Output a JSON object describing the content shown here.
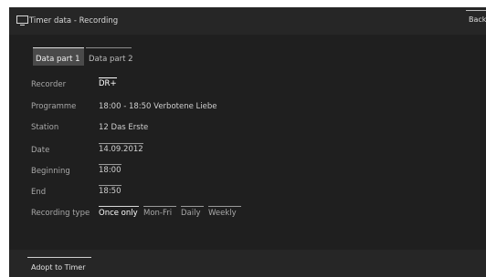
{
  "window": {
    "title": "Timer data - Recording",
    "icon": "tv-icon"
  },
  "header": {
    "back_label": "Back"
  },
  "tabs": [
    {
      "label": "Data part 1",
      "active": true
    },
    {
      "label": "Data part 2",
      "active": false
    }
  ],
  "fields": {
    "recorder": {
      "label": "Recorder",
      "value": "DR+"
    },
    "programme": {
      "label": "Programme",
      "value": "18:00 - 18:50 Verbotene Liebe"
    },
    "station": {
      "label": "Station",
      "value": "12 Das Erste"
    },
    "date": {
      "label": "Date",
      "value": "14.09.2012"
    },
    "beginning": {
      "label": "Beginning",
      "value": "18:00"
    },
    "end": {
      "label": "End",
      "value": "18:50"
    },
    "recording_type": {
      "label": "Recording type",
      "options": [
        "Once only",
        "Mon-Fri",
        "Daily",
        "Weekly"
      ],
      "selected": "Once only"
    }
  },
  "footer": {
    "adopt_label": "Adopt to Timer"
  },
  "colors": {
    "background": "#262626",
    "content": "#1f1f1f",
    "active_tab": "#4a4a4a",
    "text": "#cfcfcf"
  }
}
